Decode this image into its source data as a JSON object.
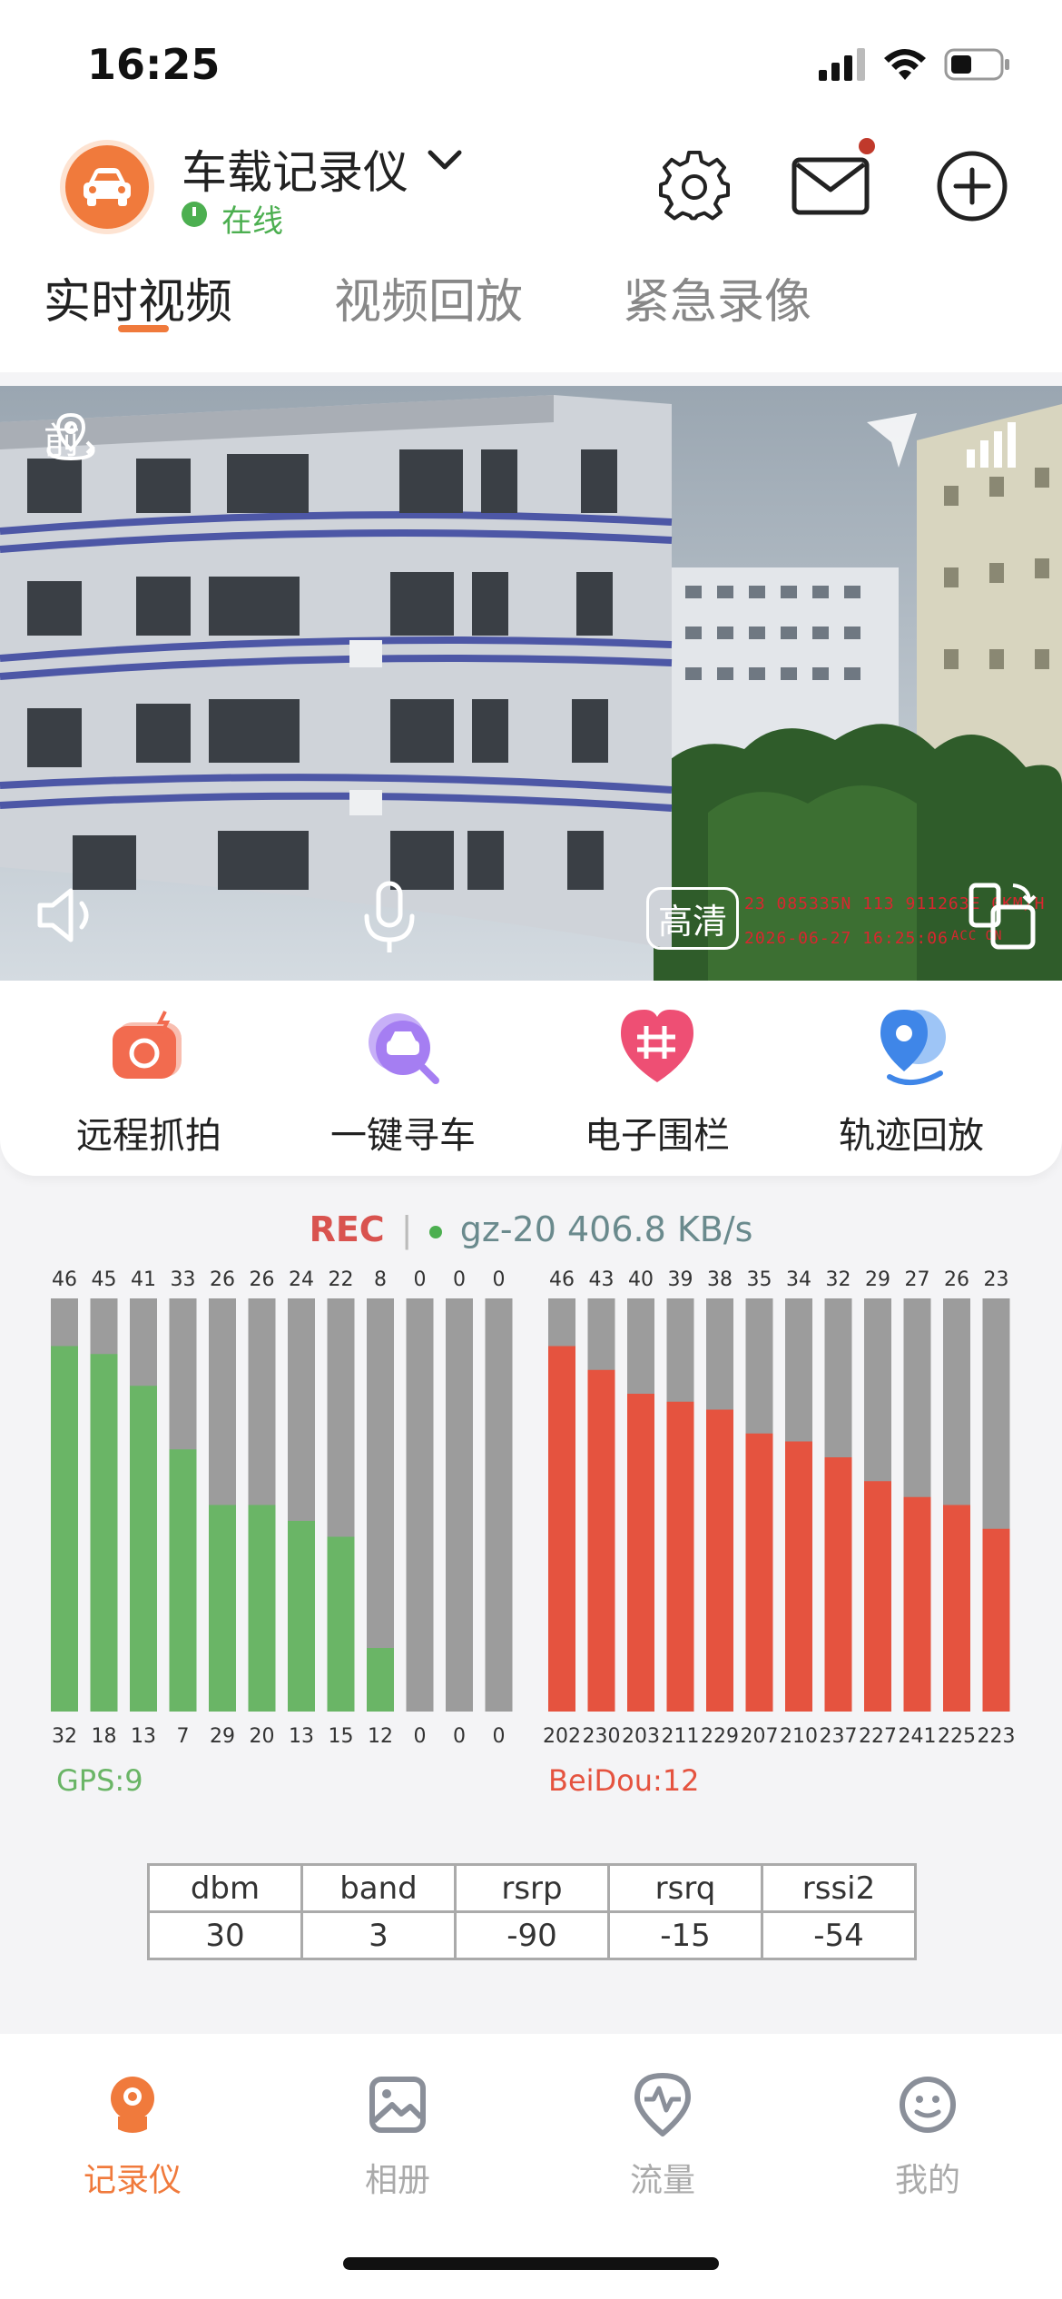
{
  "status_bar": {
    "time": "16:25"
  },
  "header": {
    "device_name": "车载记录仪",
    "status": "在线",
    "tabs": [
      {
        "label": "实时视频",
        "active": true
      },
      {
        "label": "视频回放",
        "active": false
      },
      {
        "label": "紧急录像",
        "active": false
      }
    ]
  },
  "video": {
    "camera_label": "前",
    "quality_label": "高清",
    "osd": {
      "coords": "23 085335N 113 911263E 0KM/H",
      "datetime": "2026-06-27 16:25:06",
      "acc": "ACC ON"
    }
  },
  "functions": [
    {
      "label": "远程抓拍",
      "icon": "camera-icon",
      "color": "#f26b4f"
    },
    {
      "label": "一键寻车",
      "icon": "find-car-icon",
      "color": "#a57ef2"
    },
    {
      "label": "电子围栏",
      "icon": "fence-icon",
      "color": "#ee4f74"
    },
    {
      "label": "轨迹回放",
      "icon": "track-icon",
      "color": "#3f86e8"
    }
  ],
  "record": {
    "rec": "REC",
    "separator": "|",
    "rate": "gz-20 406.8 KB/s"
  },
  "chart_data": [
    {
      "type": "bar",
      "label": "GPS:9",
      "color": "#6ab566",
      "background_color": "#9c9c9c",
      "values": [
        46,
        45,
        41,
        33,
        26,
        26,
        24,
        22,
        8,
        0,
        0,
        0
      ],
      "ids": [
        "32",
        "18",
        "13",
        "7",
        "29",
        "20",
        "13",
        "15",
        "12",
        "0",
        "0",
        "0"
      ],
      "ylim": [
        0,
        52
      ]
    },
    {
      "type": "bar",
      "label": "BeiDou:12",
      "color": "#e5533f",
      "background_color": "#9c9c9c",
      "values": [
        46,
        43,
        40,
        39,
        38,
        35,
        34,
        32,
        29,
        27,
        26,
        23
      ],
      "ids": [
        "202",
        "230",
        "203",
        "211",
        "229",
        "207",
        "210",
        "237",
        "227",
        "241",
        "225",
        "223"
      ],
      "ylim": [
        0,
        52
      ]
    }
  ],
  "signal_table": {
    "headers": [
      "dbm",
      "band",
      "rsrp",
      "rsrq",
      "rssi2"
    ],
    "values": [
      "30",
      "3",
      "-90",
      "-15",
      "-54"
    ]
  },
  "tab_bar": [
    {
      "label": "记录仪",
      "icon": "recorder-icon",
      "active": true
    },
    {
      "label": "相册",
      "icon": "album-icon",
      "active": false
    },
    {
      "label": "流量",
      "icon": "traffic-icon",
      "active": false
    },
    {
      "label": "我的",
      "icon": "profile-icon",
      "active": false
    }
  ]
}
